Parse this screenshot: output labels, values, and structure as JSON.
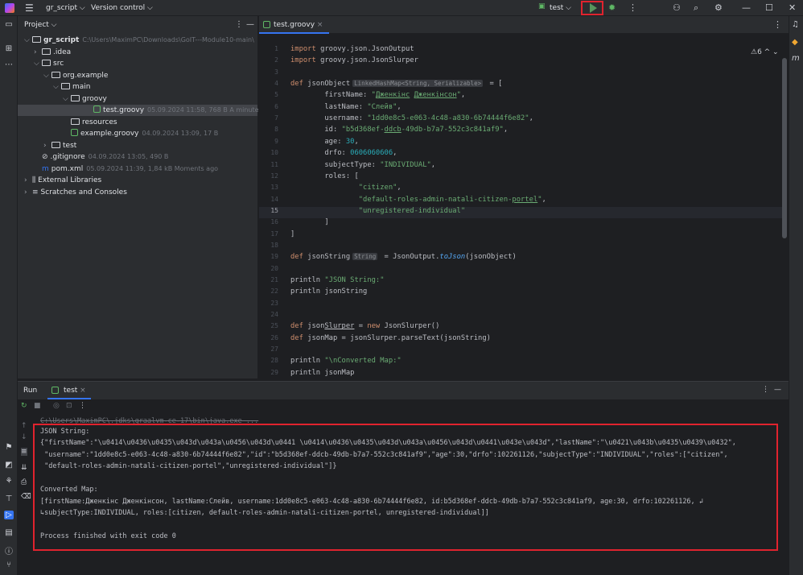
{
  "topbar": {
    "project": "gr_script ⌵",
    "vcs": "Version control ⌵",
    "run_config": "test ⌵"
  },
  "project_panel": {
    "title": "Project ⌵",
    "tree": [
      {
        "label": "gr_script",
        "meta": "C:\\Users\\MaximPC\\Downloads\\GoIT---Module10-main\\",
        "indent": 0,
        "chev": "⌵",
        "icon": "folder",
        "bold": true
      },
      {
        "label": ".idea",
        "meta": "",
        "indent": 1,
        "chev": "›",
        "icon": "folder"
      },
      {
        "label": "src",
        "meta": "",
        "indent": 1,
        "chev": "⌵",
        "icon": "folder"
      },
      {
        "label": "org.example",
        "meta": "",
        "indent": 2,
        "chev": "⌵",
        "icon": "folder"
      },
      {
        "label": "main",
        "meta": "",
        "indent": 3,
        "chev": "⌵",
        "icon": "folder"
      },
      {
        "label": "groovy",
        "meta": "",
        "indent": 4,
        "chev": "⌵",
        "icon": "folder"
      },
      {
        "label": "test.groovy",
        "meta": "05.09.2024 11:58, 768 B A minute ago",
        "indent": 5,
        "chev": "",
        "icon": "groovy",
        "selected": true
      },
      {
        "label": "resources",
        "meta": "",
        "indent": 4,
        "chev": "",
        "icon": "folder"
      },
      {
        "label": "example.groovy",
        "meta": "04.09.2024 13:09, 17 B",
        "indent": 4,
        "chev": "",
        "icon": "groovy"
      },
      {
        "label": "test",
        "meta": "",
        "indent": 2,
        "chev": "›",
        "icon": "folder"
      },
      {
        "label": ".gitignore",
        "meta": "04.09.2024 13:05, 490 B",
        "indent": 1,
        "chev": "",
        "icon": "ignore"
      },
      {
        "label": "pom.xml",
        "meta": "05.09.2024 11:39, 1,84 kB Moments ago",
        "indent": 1,
        "chev": "",
        "icon": "maven"
      },
      {
        "label": "External Libraries",
        "meta": "",
        "indent": 0,
        "chev": "›",
        "icon": "lib"
      },
      {
        "label": "Scratches and Consoles",
        "meta": "",
        "indent": 0,
        "chev": "›",
        "icon": "scratch"
      }
    ]
  },
  "editor": {
    "tab": "test.groovy",
    "warnings": "⚠6 ^ ⌄",
    "line_numbers": [
      "1",
      "2",
      "3",
      "4",
      "5",
      "6",
      "7",
      "8",
      "9",
      "10",
      "11",
      "12",
      "13",
      "14",
      "15",
      "16",
      "17",
      "18",
      "19",
      "20",
      "21",
      "22",
      "23",
      "24",
      "25",
      "26",
      "27",
      "28",
      "29"
    ]
  },
  "run": {
    "label": "Run",
    "tab": "test",
    "console": [
      "C:\\Users\\MaximPC\\.jdks\\graalvm-ce-17\\bin\\java.exe ...",
      "JSON String:",
      "{\"firstName\":\"\\u0414\\u0436\\u0435\\u043d\\u043a\\u0456\\u043d\\u0441 \\u0414\\u0436\\u0435\\u043d\\u043a\\u0456\\u043d\\u0441\\u043e\\u043d\",\"lastName\":\"\\u0421\\u043b\\u0435\\u0439\\u0432\",",
      " \"username\":\"1dd0e8c5-e063-4c48-a830-6b74444f6e82\",\"id\":\"b5d368ef-ddcb-49db-b7a7-552c3c841af9\",\"age\":30,\"drfo\":102261126,\"subjectType\":\"INDIVIDUAL\",\"roles\":[\"citizen\",",
      " \"default-roles-admin-natali-citizen-portel\",\"unregistered-individual\"]}",
      "",
      "Converted Map:",
      "[firstName:Дженкінс Дженкінсон, lastName:Слейв, username:1dd0e8c5-e063-4c48-a830-6b74444f6e82, id:b5d368ef-ddcb-49db-b7a7-552c3c841af9, age:30, drfo:102261126, ↲",
      "↳subjectType:INDIVIDUAL, roles:[citizen, default-roles-admin-natali-citizen-portel, unregistered-individual]]",
      "",
      "Process finished with exit code 0"
    ]
  }
}
